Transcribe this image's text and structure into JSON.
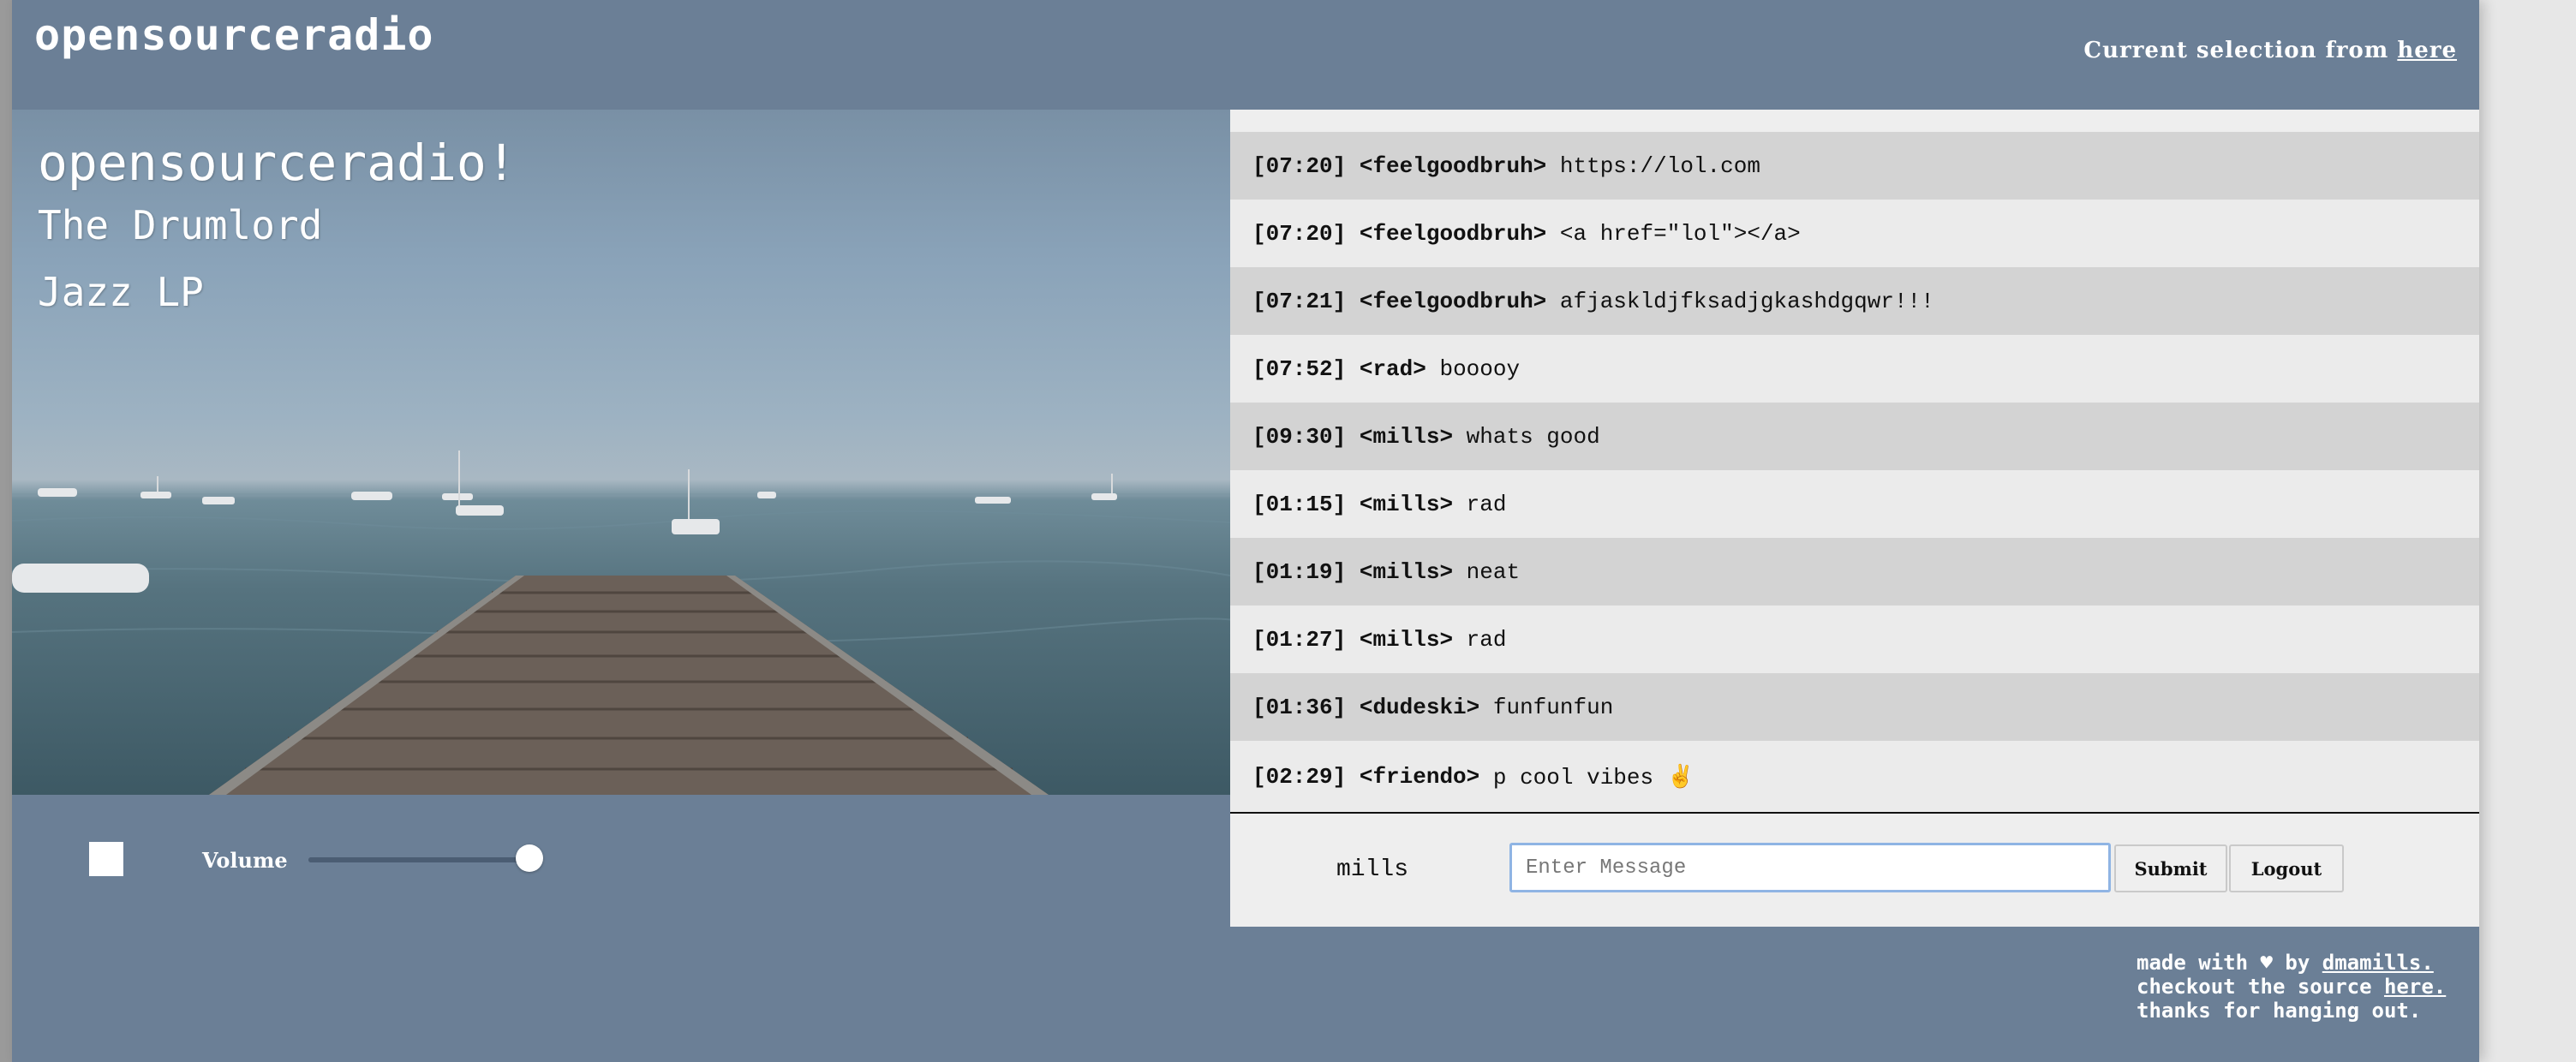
{
  "header": {
    "title": "opensourceradio",
    "selection_prefix": "Current selection from ",
    "selection_link": "here"
  },
  "player": {
    "overlay_title": "opensourceradio!",
    "artist": "The Drumlord",
    "album": "Jazz LP",
    "play_state": "stopped",
    "volume_label": "Volume",
    "volume_level": 1.0
  },
  "chat": {
    "messages": [
      {
        "time": "[07:20]",
        "user": "feelgoodbruh",
        "text": "https://lol.com"
      },
      {
        "time": "[07:20]",
        "user": "feelgoodbruh",
        "text": "<a href=\"lol\"></a>"
      },
      {
        "time": "[07:21]",
        "user": "feelgoodbruh",
        "text": "afjaskldjfksadjgkashdgqwr!!!"
      },
      {
        "time": "[07:52]",
        "user": "rad",
        "text": "booooy"
      },
      {
        "time": "[09:30]",
        "user": "mills",
        "text": "whats good"
      },
      {
        "time": "[01:15]",
        "user": "mills",
        "text": "rad"
      },
      {
        "time": "[01:19]",
        "user": "mills",
        "text": "neat"
      },
      {
        "time": "[01:27]",
        "user": "mills",
        "text": "rad"
      },
      {
        "time": "[01:36]",
        "user": "dudeski",
        "text": "funfunfun"
      },
      {
        "time": "[02:29]",
        "user": "friendo",
        "text": "p cool vibes ✌️"
      }
    ],
    "username": "mills",
    "input_placeholder": "Enter Message",
    "input_value": "",
    "submit_label": "Submit",
    "logout_label": "Logout"
  },
  "footer": {
    "line1_prefix": "made with ♥ by ",
    "line1_link": "dmamills.",
    "line2_prefix": "checkout the source ",
    "line2_link": "here.",
    "line3": "thanks for hanging out."
  },
  "colors": {
    "page_bg": "#6b7f96",
    "chat_row_dark": "#d3d3d3",
    "chat_row_light": "#ebebeb",
    "input_focus_border": "#8fb4e4"
  }
}
